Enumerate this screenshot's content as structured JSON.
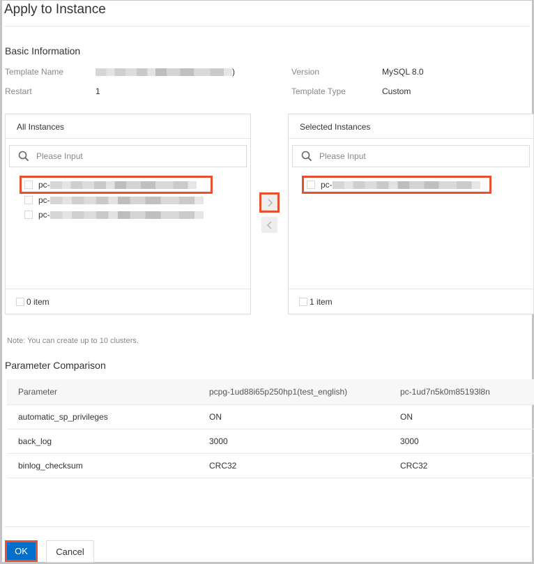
{
  "dialog": {
    "title": "Apply to Instance"
  },
  "basic_info": {
    "section_title": "Basic Information",
    "template_name_label": "Template Name",
    "template_name_value_suffix": ")",
    "restart_label": "Restart",
    "restart_value": "1",
    "version_label": "Version",
    "version_value": "MySQL 8.0",
    "template_type_label": "Template Type",
    "template_type_value": "Custom"
  },
  "transfer": {
    "left": {
      "title": "All Instances",
      "search_placeholder": "Please Input",
      "items": [
        {
          "prefix": "pc-",
          "highlighted": true
        },
        {
          "prefix": "pc-",
          "highlighted": false
        },
        {
          "prefix": "pc-",
          "highlighted": false
        }
      ],
      "footer_count": "0 item"
    },
    "right": {
      "title": "Selected Instances",
      "search_placeholder": "Please Input",
      "items": [
        {
          "prefix": "pc-",
          "highlighted": true
        }
      ],
      "footer_count": "1 item"
    },
    "move_right_icon": "chevron-right-icon",
    "move_left_icon": "chevron-left-icon"
  },
  "note": "Note: You can create up to 10 clusters.",
  "comparison": {
    "section_title": "Parameter Comparison",
    "columns": [
      "Parameter",
      "pcpg-1ud88i65p250hp1(test_english)",
      "pc-1ud7n5k0m85193l8n"
    ],
    "rows": [
      [
        "automatic_sp_privileges",
        "ON",
        "ON"
      ],
      [
        "back_log",
        "3000",
        "3000"
      ],
      [
        "binlog_checksum",
        "CRC32",
        "CRC32"
      ]
    ]
  },
  "footer": {
    "ok_label": "OK",
    "cancel_label": "Cancel"
  },
  "colors": {
    "primary": "#0070cc",
    "highlight": "#e8512d"
  }
}
